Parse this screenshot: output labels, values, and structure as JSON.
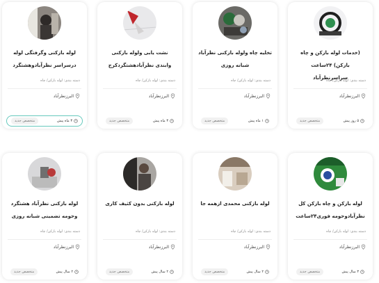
{
  "cards": [
    {
      "title": "لوله بازکنی وگرفتگی لوله درسراسر نظرآبادوهشتگرد",
      "category": "دسته بندی: لوله بازکن/ چاه",
      "location": "البرزنظرآباد",
      "time": "۳ ماه پیش",
      "badge": "متخصص جدید",
      "active": true
    },
    {
      "title": "نشت یابی ولوله بازکنی وابندی نظرآبادهشتگردکرج",
      "category": "دسته بندی: لوله بازکن/ چاه",
      "location": "البرزنظرآباد",
      "time": "۳ ماه پیش",
      "badge": "متخصص جدید"
    },
    {
      "title": "تخلیه چاه ولوله بازکنی نظرآباد شبانه روزی",
      "category": "دسته بندی: لوله بازکن/ چاه",
      "location": "البرزنظرآباد",
      "time": "۱ ماه پیش",
      "badge": "متخصص جدید"
    },
    {
      "title": "(خدمات لوله بازکن و چاه بازکن) ۲۴ساعت سراسرنظرآباد",
      "category": "دسته بندی: لوله بازکن/ چاه",
      "location": "البرزنظرآباد",
      "time": "۵ روز پیش",
      "badge": "متخصص جدید"
    },
    {
      "title": "لوله بازکنی نظرآباد هشتگرد وحومه تضمینی شبانه روزی",
      "category": "دسته بندی: لوله بازکن/ چاه",
      "location": "البرزنظرآباد",
      "time": "۲ سال پیش",
      "badge": "متخصص جدید"
    },
    {
      "title": "لوله بازکنی بدون کثیف کاری",
      "category": "دسته بندی: لوله بازکن/ چاه",
      "location": "البرزنظرآباد",
      "time": "۲ سال پیش",
      "badge": "متخصص جدید"
    },
    {
      "title": "لوله بازکنی محمدی ازهمه جا",
      "category": "دسته بندی: لوله بازکن/ چاه",
      "location": "البرزنظرآباد",
      "time": "۲ سال پیش",
      "badge": "متخصص جدید"
    },
    {
      "title": "لوله بازکن و چاه بازکن کل نظرآبادوحومه فوری۲۴ساعت",
      "category": "دسته بندی: لوله بازکن/ چاه",
      "location": "البرزنظرآباد",
      "time": "۳ سال پیش",
      "badge": "متخصص جدید"
    }
  ]
}
